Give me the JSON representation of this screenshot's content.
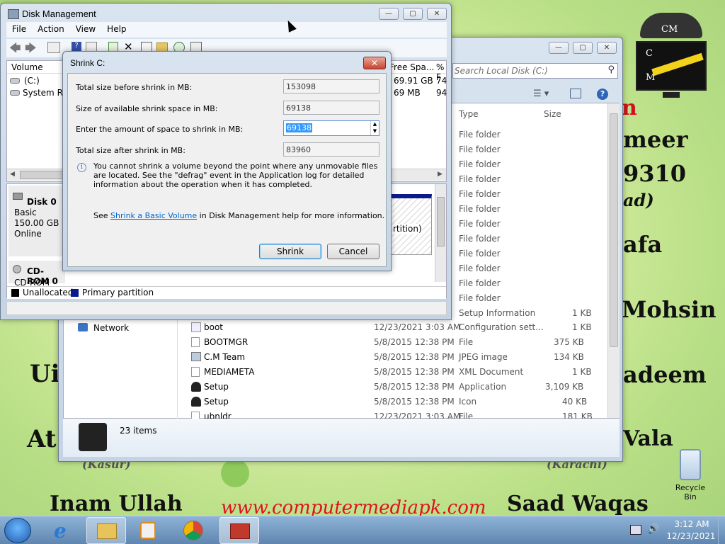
{
  "wallpaper": {
    "lines": [
      "meer",
      "9310",
      "ad)",
      "afa",
      "Mohsin",
      "adeem",
      "Vala",
      "Ui",
      "At",
      "Inam Ullah",
      "Saad Waqas",
      "(Karachi)",
      "(Kasur)",
      "n"
    ],
    "website": "www.computermediapk.com",
    "logo_letters": [
      "CM",
      "C",
      "M"
    ],
    "recycle_bin_label": "Recycle Bin"
  },
  "explorer": {
    "search_placeholder": "Search Local Disk (C:)",
    "col_type": "Type",
    "col_size": "Size",
    "folder_rows": [
      "File folder",
      "File folder",
      "File folder",
      "File folder",
      "File folder",
      "File folder",
      "File folder",
      "File folder",
      "File folder",
      "File folder",
      "File folder",
      "File folder"
    ],
    "setup_info_row": {
      "type": "Setup Information",
      "size": "1 KB"
    },
    "nav_network": "Network",
    "files": [
      {
        "name": "boot",
        "date": "12/23/2021 3:03 AM",
        "type": "Configuration sett...",
        "size": "1 KB"
      },
      {
        "name": "BOOTMGR",
        "date": "5/8/2015 12:38 PM",
        "type": "File",
        "size": "375 KB"
      },
      {
        "name": "C.M Team",
        "date": "5/8/2015 12:38 PM",
        "type": "JPEG image",
        "size": "134 KB"
      },
      {
        "name": "MEDIAMETA",
        "date": "5/8/2015 12:38 PM",
        "type": "XML Document",
        "size": "1 KB"
      },
      {
        "name": "Setup",
        "date": "5/8/2015 12:38 PM",
        "type": "Application",
        "size": "3,109 KB"
      },
      {
        "name": "Setup",
        "date": "5/8/2015 12:38 PM",
        "type": "Icon",
        "size": "40 KB"
      },
      {
        "name": "ubnldr",
        "date": "12/23/2021 3:03 AM",
        "type": "File",
        "size": "181 KB"
      }
    ],
    "items_count": "23 items"
  },
  "diskmgmt": {
    "title": "Disk Management",
    "menu": [
      "File",
      "Action",
      "View",
      "Help"
    ],
    "col_volume": "Volume",
    "col_free": "Free Spa...",
    "col_pct": "% F",
    "volumes": [
      {
        "name": "(C:)",
        "free": "69.91 GB",
        "pct": "74"
      },
      {
        "name": "System Res",
        "free": "69 MB",
        "pct": "94"
      }
    ],
    "disk0": {
      "label": "Disk 0",
      "type": "Basic",
      "size": "150.00 GB",
      "status": "Online"
    },
    "partition_text": "rtition)",
    "cdrom": {
      "label": "CD-ROM 0",
      "drive": "CD-ROM (D:)"
    },
    "legend": [
      "Unallocated",
      "Primary partition"
    ]
  },
  "dialog": {
    "title": "Shrink C:",
    "total_before_label": "Total size before shrink in MB:",
    "total_before_value": "153098",
    "available_label": "Size of available shrink space in MB:",
    "available_value": "69138",
    "enter_label": "Enter the amount of space to shrink in MB:",
    "enter_value": "69138",
    "total_after_label": "Total size after shrink in MB:",
    "total_after_value": "83960",
    "info_text": "You cannot shrink a volume beyond the point where any unmovable files are located. See the \"defrag\" event in the Application log for detailed information about the operation when it has completed.",
    "see_prefix": "See",
    "see_link": "Shrink a Basic Volume",
    "see_suffix": "in Disk Management help for more information.",
    "shrink_button": "Shrink",
    "cancel_button": "Cancel"
  },
  "taskbar": {
    "time": "3:12 AM",
    "date": "12/23/2021"
  }
}
